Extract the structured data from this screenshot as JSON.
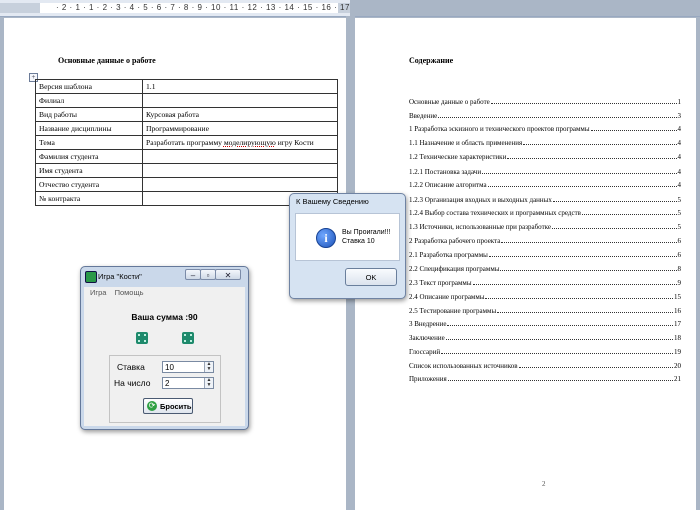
{
  "ruler": {
    "numbers": "· 2 · 1 · 1 · 2 · 3 · 4 · 5 · 6 · 7 · 8 · 9 · 10 · 11 · 12 · 13 · 14 · 15 · 16 · 17 · 18"
  },
  "left_page": {
    "title": "Основные данные о работе",
    "table": [
      {
        "key": "Версия шаблона",
        "value": "1.1"
      },
      {
        "key": "Филиал",
        "value": ""
      },
      {
        "key": "Вид работы",
        "value": "Курсовая работа"
      },
      {
        "key": "Название дисциплины",
        "value": "Программирование"
      },
      {
        "key": "Тема",
        "value": "Разработать программу моделирующую игру Кости"
      },
      {
        "key": "Фамилия студента",
        "value": ""
      },
      {
        "key": "Имя студента",
        "value": ""
      },
      {
        "key": "Отчество студента",
        "value": ""
      },
      {
        "key": "№ контракта",
        "value": ""
      }
    ]
  },
  "right_page": {
    "title": "Содержание",
    "toc": [
      {
        "text": "Основные данные о работе",
        "page": "1"
      },
      {
        "text": "Введение",
        "page": "3"
      },
      {
        "text": "1 Разработка эскизного и технического проектов программы",
        "page": "4"
      },
      {
        "text": "1.1  Назначение и область применения",
        "page": "4"
      },
      {
        "text": "1.2 Технические характеристики",
        "page": "4"
      },
      {
        "text": "1.2.1 Постановка задачи",
        "page": "4"
      },
      {
        "text": "1.2.2  Описание алгоритма",
        "page": "4"
      },
      {
        "text": "1.2.3 Организация входных и выходных данных",
        "page": "5"
      },
      {
        "text": "1.2.4 Выбор состава технических и программных средств",
        "page": "5"
      },
      {
        "text": "1.3 Источники, использованные при разработке",
        "page": "5"
      },
      {
        "text": "2 Разработка рабочего проекта",
        "page": "6"
      },
      {
        "text": "2.1 Разработка программы",
        "page": "6"
      },
      {
        "text": "2.2 Спецификация программы",
        "page": "8"
      },
      {
        "text": "2.3 Текст программы",
        "page": "9"
      },
      {
        "text": "2.4 Описание программы",
        "page": "15"
      },
      {
        "text": "2.5 Тестирование программы",
        "page": "16"
      },
      {
        "text": "3 Внедрение",
        "page": "17"
      },
      {
        "text": "Заключение",
        "page": "18"
      },
      {
        "text": "Глоссарий",
        "page": "19"
      },
      {
        "text": "Список использованных источников",
        "page": "20"
      },
      {
        "text": "Приложения",
        "page": "21"
      }
    ],
    "page_number": "2"
  },
  "dialog": {
    "title": "К Вашему Сведению",
    "icon": "information-icon",
    "message_line1": "Вы Проигали!!!",
    "message_line2": "Ставка 10",
    "ok_label": "OK"
  },
  "game": {
    "title": "Игра \"Кости\"",
    "menu": [
      "Игра",
      "Помощь"
    ],
    "sum_text": "Ваша сумма :90",
    "stake_label": "Ставка",
    "stake_value": "10",
    "number_label": "На число",
    "number_value": "2",
    "roll_label": "Бросить",
    "dice_color": "#1e8a6c"
  }
}
